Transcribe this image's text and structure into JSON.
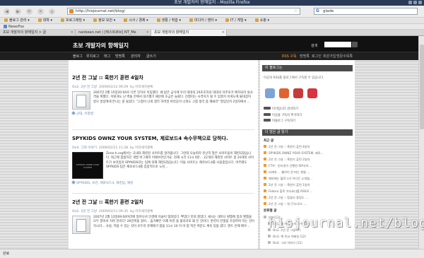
{
  "window": {
    "title": "초보 개발자의 항해일지 - Mozilla Firefox"
  },
  "toolbar": {
    "url": "http://hisjournal.net/blog/",
    "search_value": "glade",
    "back": "◀",
    "forward": "▶",
    "reload": "⟳",
    "stop": "✕",
    "home": "⌂"
  },
  "bookmarks": [
    "블로그 관리",
    "대학",
    "프로그래밍",
    "정보 보안",
    "시사 / 경제",
    "생활 / 취습",
    "미디어 / 엔터",
    "IT / 게임",
    "쇼핑"
  ],
  "newsfox": "NewsFox",
  "tabs": [
    {
      "label": "초보 개발자의 항해일지 > 글",
      "active": false
    },
    {
      "label": "nanbean.net | [텍스트큐브] NT_Me",
      "active": false
    },
    {
      "label": "초보 개발자의 항해일지",
      "active": true
    }
  ],
  "site": {
    "title": "초보 개발자의 항해일지",
    "search_label": "검색",
    "menu": [
      "블로그",
      "위치로그",
      "태그",
      "방명록",
      "관리자",
      "글쓰기"
    ],
    "rss": "RSS 구독",
    "right_links": [
      "방명록",
      "로그인",
      "회원가입",
      "방문수목록"
    ]
  },
  "posts": [
    {
      "title": "2년 전 그날 :: 훅한기 훈련 4일차",
      "cat": "On2. 2년 전 그날",
      "date": "2009/02/12 09:29",
      "author": "by 어리세치센톡",
      "body": "2007년 2월 15일20:00로 다른 친지로 이동했다. 왜 없은 급식에 우리 대대의 29초호차의 대대의 자주포가 배치되어 실사격을 위했다. 이렇게도 난 벽돌 안에서 대기했기 때문에 조금은 놀랐다. 진행지는 사격지가 될 수 있겠지 이게도에 불대장이 방으 방장에게 튼니는 걸 들었다. \"고참이 너희 생각 하려일 바라듣이 너희도 고참 생각 좀 해봐라\" 말입인지 2일차에서 ...",
      "tags": "군대, 이창병",
      "thumb": "doc"
    },
    {
      "title": "SPYKIDS OWNZ YOUR SYSTEM, 제로보드4 속수무책으로 당하다.",
      "cat": "On4. 그외 이야기",
      "date": "2009/02/11 11:28",
      "author": "by 어리세치센톡",
      "body": "Zone-h.org에서는 국내의 해킹된 사이트를 알려줍니다. 그런데 오늘따라 유난히 많은 사이트들이 해킹되었습니다. 최근에 점점하던 개발 버그패치 이에쓰면인가요. 현재 시각 11시 6분... 22개의 해킹된 사이트 중 20개의 사이트가 보라입의 SPYKIDS라는 팀에 의해 해킹되었습니다. 이들 사이트는 제로보드4를 사용중입니다. 아무래도 SPYKIDS 팀은 제로보드4를 집중적으로 노린...",
      "tags": "SPYKIDS, 보안, 제로보드4, 해킹팀, 해킹",
      "thumb": "dark",
      "thumb_caption": "SPYKIDS OWNZ YOUR SYSTEM"
    },
    {
      "title": "2년 전 그날 :: 훅한기 훈련 2일차",
      "cat": "On2. 2년 전 그날",
      "date": "2009/02/11 09:35",
      "author": "by 어리세치센톡",
      "body": "2007년 2월 13일09:00이라에 일어나서 안경에 이슬이 맺혀있다. 뿌었다 붓혀 졌었다. 새사는 대미나 판뽑에 밤과 밴뽑을 모두 말아서 지퍼 만라다! 26만퍼을 걸어... 숨가빠은 이제 이천 을 올리라로 돼 은 것이다. 훈련이 전쟁을 가정하며 하는 것이지시라... 사실, 적을 수 있는 것이 모두라 유제에기 점들 11시 10 이 야 밥 적은 위문도 계속 있을 였다. 텐트 안에 배우...",
      "tags": "",
      "thumb": "doc"
    }
  ],
  "sidebar": {
    "about_title": "이 블로그는",
    "about_text": "이곳의 RSS를 블로그에서 구독할 수 있습니다.",
    "icons": [
      {
        "name": "rss-reader-icon",
        "color": "#7ea3d6"
      },
      {
        "name": "hanrss-icon",
        "color": "#e0622d"
      },
      {
        "name": "nate-icon",
        "color": "#c73a3a"
      },
      {
        "name": "press-blog-icon",
        "color": "#d6343f"
      }
    ],
    "links": [
      "이거입니다 관리하기",
      "이곳을 구독자 추가하기",
      "이블로그 구독하기"
    ],
    "recent_title": "더 많은 글 읽기",
    "recent_sub": "최근 글",
    "recent": [
      "2년 전 그날 :: 훅한기 훈련 4일차",
      "SPYKIDS OWNZ YOUR SYSTEM, 제로...",
      "2년 전 그날 :: 훅한기 훈련 2일차",
      "CTH - 인터넷이 간행된 ISP사의 ...",
      "비캐쉬 ... 웹아이 안 떠는 위험 ...",
      "해외에는 블로그가 어디든 소개될...",
      "2년 전 그날 :: 훅한기 훈련 1일차",
      "Fedora 할로 기타요다를 RSS로 ...",
      "2년 전 그날 :: 컴퓨터 중앙도 ...",
      "2년 전 그날 :: 첫 (?)소모드 ..."
    ],
    "cat_sub": "분류별 글",
    "categories": [
      "부분(12)",
      "On1. 내 마리 속의 노수 (34)",
      "On2. 2년 전 그날 (7)",
      "On3. 책 독서 이매일 (12)",
      "On4. 그외 이야기 (11)"
    ]
  },
  "status": "완료",
  "watermark": "hisjournal.net/blog"
}
